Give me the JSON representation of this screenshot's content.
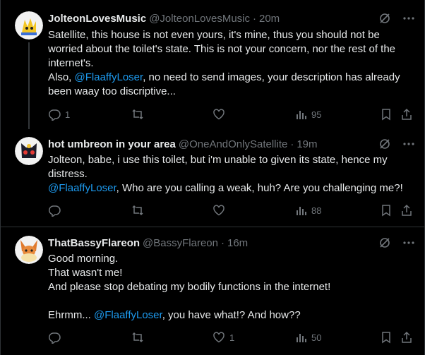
{
  "posts": [
    {
      "name": "JolteonLovesMusic",
      "handle": "@JolteonLovesMusic",
      "time": "20m",
      "lines": [
        {
          "parts": [
            {
              "t": "Satellite, this house is not even yours, it's mine, thus you should not be worried about the toilet's state. This is not your concern, nor the rest of the internet's."
            }
          ]
        },
        {
          "parts": [
            {
              "t": "Also, "
            },
            {
              "t": "@FlaaffyLoser",
              "m": true
            },
            {
              "t": ", no need to send images, your description has already been waay too discriptive..."
            }
          ]
        }
      ],
      "replies": "1",
      "reposts": "",
      "likes": "",
      "views": "95"
    },
    {
      "name": "hot umbreon in your area",
      "handle": "@OneAndOnlySatellite",
      "time": "19m",
      "lines": [
        {
          "parts": [
            {
              "t": "Jolteon, babe, i use this toilet, but i'm unable to given its state, hence my distress."
            }
          ]
        },
        {
          "parts": [
            {
              "t": "@FlaaffyLoser",
              "m": true
            },
            {
              "t": ", Who are you calling a weak, huh? Are you challenging me?!"
            }
          ]
        }
      ],
      "replies": "",
      "reposts": "",
      "likes": "",
      "views": "88"
    },
    {
      "name": "ThatBassyFlareon",
      "handle": "@BassyFlareon",
      "time": "16m",
      "lines": [
        {
          "parts": [
            {
              "t": "Good morning."
            }
          ]
        },
        {
          "parts": [
            {
              "t": "That wasn't me!"
            }
          ]
        },
        {
          "parts": [
            {
              "t": "And please stop debating my bodily functions in the internet!"
            }
          ]
        },
        {
          "parts": []
        },
        {
          "parts": [
            {
              "t": "Ehrmm... "
            },
            {
              "t": "@FlaaffyLoser",
              "m": true
            },
            {
              "t": ", you have what!? And how??"
            }
          ]
        }
      ],
      "replies": "",
      "reposts": "",
      "likes": "1",
      "views": "50"
    }
  ],
  "colors": {
    "background": "#000000",
    "text": "#e7e9ea",
    "muted": "#71767b",
    "mention": "#1d9bf0",
    "divider": "#2f3336"
  },
  "icons": [
    "grok-icon",
    "more-icon",
    "reply-icon",
    "repost-icon",
    "like-icon",
    "views-icon",
    "bookmark-icon",
    "share-icon"
  ]
}
